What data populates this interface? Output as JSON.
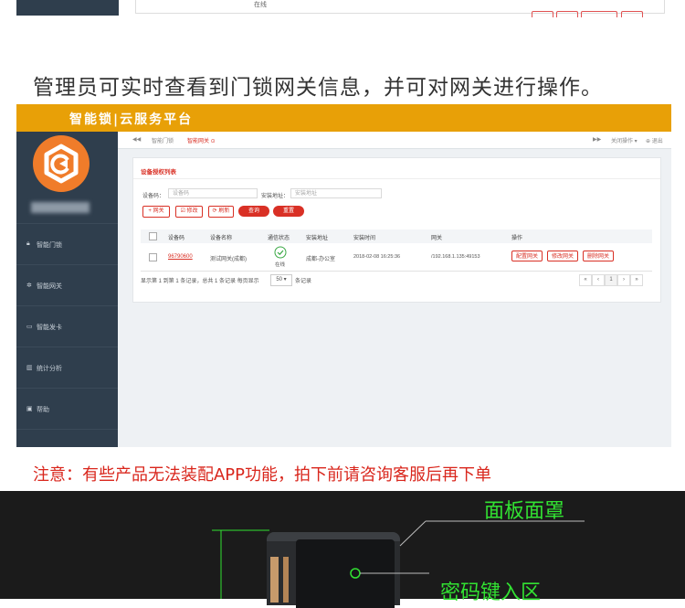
{
  "top_strip": {
    "online": "在线"
  },
  "caption": "管理员可实时查看到门锁网关信息，并可对网关进行操作。",
  "app": {
    "brand_title": "智能锁|云服务平台",
    "sidebar": {
      "items": [
        {
          "label": "智能门锁",
          "icon": "lock-icon"
        },
        {
          "label": "智能网关",
          "icon": "gear-icon"
        },
        {
          "label": "智能发卡",
          "icon": "card-icon"
        },
        {
          "label": "统计分析",
          "icon": "chart-icon"
        },
        {
          "label": "帮助",
          "icon": "monitor-icon"
        }
      ]
    },
    "tabs": {
      "back": "◀◀",
      "tab1": "智能门锁",
      "tab2": "智能网关 ⊙",
      "forward": "▶▶",
      "close_ops": "关闭操作 ▾",
      "logout": "⊕ 退出"
    },
    "panel": {
      "title": "设备授权列表",
      "device_code_label": "设备码：",
      "device_code_placeholder": "设备码",
      "address_label": "安装地址：",
      "address_placeholder": "安装地址",
      "btn_add": "+ 网关",
      "btn_edit": "☑ 修改",
      "btn_refresh": "⟳ 刷新",
      "btn_query": "查询",
      "btn_reset": "重置",
      "columns": [
        "设备码",
        "设备名称",
        "通信状态",
        "安装地址",
        "安装时间",
        "网关",
        "操作"
      ],
      "rows": [
        {
          "code": "96790600",
          "name": "测试网关(成都)",
          "status": "在线",
          "address": "成都-办公室",
          "time": "2018-02-08 16:25:36",
          "gateway": "/192.168.1.135:49153",
          "op1": "配置网关",
          "op2": "修改网关",
          "op3": "删除网关"
        }
      ],
      "pager_info": "显示第 1 到第 1 条记录，总共 1 条记录 每页显示",
      "page_size": "50 ▾",
      "pager_suffix": "条记录",
      "pages": [
        "«",
        "‹",
        "1",
        "›",
        "»"
      ]
    }
  },
  "note": "注意：有些产品无法装配APP功能，拍下前请咨询客服后再下单",
  "product": {
    "label_panel": "面板面罩",
    "label_keypad": "密码键入区"
  },
  "colors": {
    "brand": "#e8a007",
    "sidebar": "#2f3e4d",
    "accent_red": "#d93025",
    "label_green": "#32e232"
  }
}
